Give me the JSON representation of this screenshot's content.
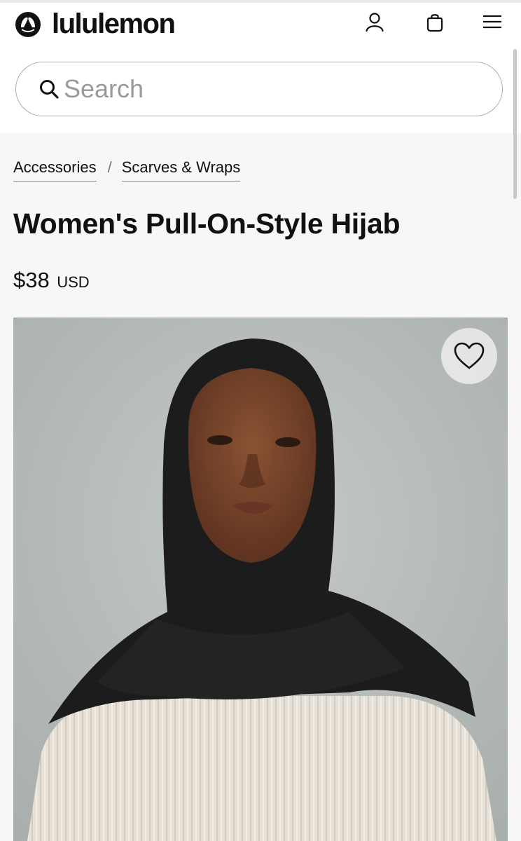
{
  "header": {
    "brand": "lululemon",
    "icons": [
      "lululemon-logo-icon",
      "account-icon",
      "bag-icon",
      "menu-icon"
    ]
  },
  "search": {
    "placeholder": "Search",
    "value": ""
  },
  "breadcrumb": {
    "items": [
      {
        "label": "Accessories"
      },
      {
        "label": "Scarves & Wraps"
      }
    ],
    "separator": "/"
  },
  "product": {
    "title": "Women's Pull-On-Style Hijab",
    "price": "$38",
    "currency": "USD",
    "wishlist_icon": "heart-icon"
  },
  "colors": {
    "brand_text": "#111111",
    "image_background": "#b6bcba"
  }
}
